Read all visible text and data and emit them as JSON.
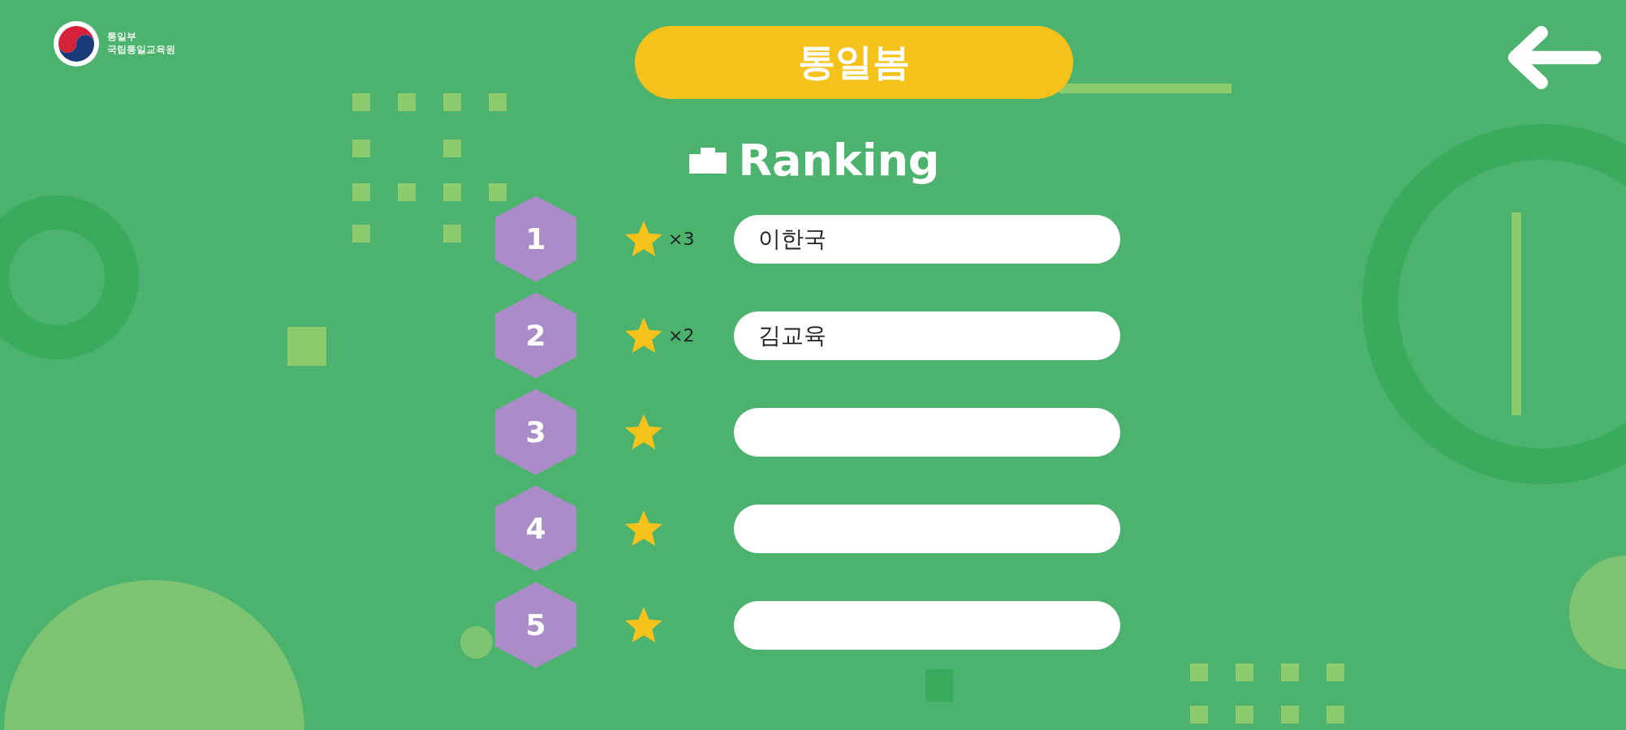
{
  "logo": {
    "lines": [
      "통일부",
      "국립통일교육원"
    ]
  },
  "title": "통일봄",
  "heading": "Ranking",
  "ranking": [
    {
      "rank": "1",
      "count": "×3",
      "name": "이한국"
    },
    {
      "rank": "2",
      "count": "×2",
      "name": "김교육"
    },
    {
      "rank": "3"
    },
    {
      "rank": "4"
    },
    {
      "rank": "5"
    }
  ]
}
